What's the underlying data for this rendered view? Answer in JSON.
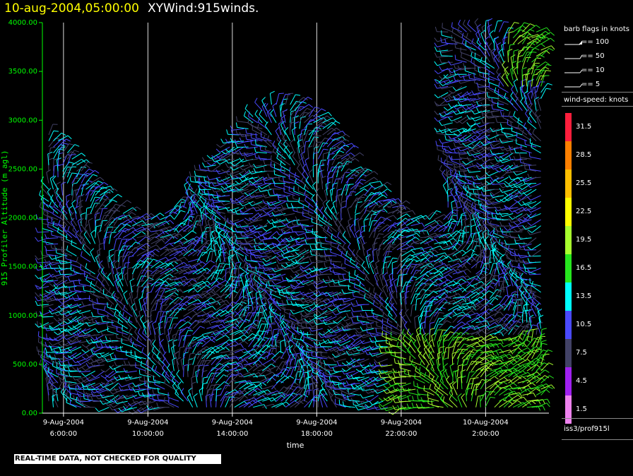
{
  "header": {
    "date": "10-aug-2004,05:00:00",
    "title": "XYWind:915winds."
  },
  "legend": {
    "barb_title": "barb flags in knots",
    "barb_entries": [
      "== 100",
      "== 50",
      "== 10",
      "== 5"
    ],
    "speed_title": "wind-speed: knots",
    "speed_colors": [
      {
        "label": "31.5",
        "color": "#ff1e3c"
      },
      {
        "label": "28.5",
        "color": "#ff8000"
      },
      {
        "label": "25.5",
        "color": "#ffbf00"
      },
      {
        "label": "22.5",
        "color": "#ffff00"
      },
      {
        "label": "19.5",
        "color": "#a8ff2e"
      },
      {
        "label": "16.5",
        "color": "#26e61e"
      },
      {
        "label": "13.5",
        "color": "#00ffff"
      },
      {
        "label": "10.5",
        "color": "#4a4aff"
      },
      {
        "label": "7.5",
        "color": "#424266"
      },
      {
        "label": "4.5",
        "color": "#a020f0"
      },
      {
        "label": "1.5",
        "color": "#ee82ee"
      }
    ],
    "station": "iss3/prof915l"
  },
  "footer": {
    "note": "REAL-TIME DATA, NOT CHECKED FOR QUALITY"
  },
  "chart_data": {
    "type": "scatter",
    "subtype": "wind-barb time-height plot",
    "xlabel": "time",
    "ylabel": "915 Profiler Altitude (m agl)",
    "ylim": [
      0,
      4000
    ],
    "yticks": [
      "0.00",
      "500.00",
      "1000.00",
      "1500.00",
      "2000.00",
      "2500.00",
      "3000.00",
      "3500.00",
      "4000.00"
    ],
    "x_ticks": [
      {
        "date": "9-Aug-2004",
        "time": "6:00:00",
        "hour": 6
      },
      {
        "date": "9-Aug-2004",
        "time": "10:00:00",
        "hour": 10
      },
      {
        "date": "9-Aug-2004",
        "time": "14:00:00",
        "hour": 14
      },
      {
        "date": "9-Aug-2004",
        "time": "18:00:00",
        "hour": 18
      },
      {
        "date": "9-Aug-2004",
        "time": "22:00:00",
        "hour": 22
      },
      {
        "date": "10-Aug-2004",
        "time": "2:00:00",
        "hour": 26
      }
    ],
    "xlim_hours": [
      5.0,
      29.0
    ],
    "grid": "vertical lines at tick times"
  }
}
